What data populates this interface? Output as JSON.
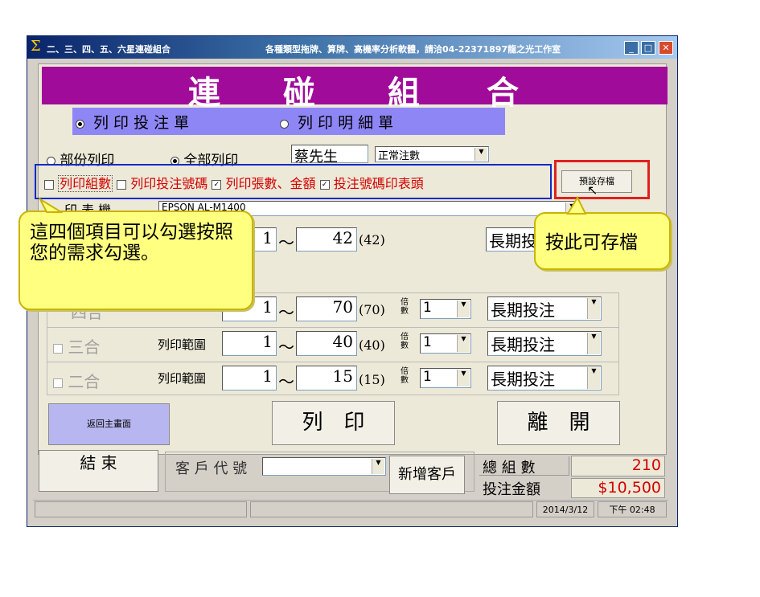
{
  "window": {
    "title": "二、三、四、五、六星連碰組合",
    "info": "各種類型拖牌、算牌、高機率分析軟體，請洽04-22371897龍之光工作室"
  },
  "banner": {
    "chars": [
      "連",
      "碰",
      "組",
      "合"
    ]
  },
  "print_mode": {
    "detail_label": "列 印 投 注 單",
    "summary_label": "列 印 明 細 單",
    "selected": "detail_label"
  },
  "scope": {
    "partial_label": "部份列印",
    "all_label": "全部列印",
    "selected": "all_label"
  },
  "customer_name": "蔡先生",
  "bet_type": "正常注數",
  "options": {
    "print_combo_count": "列印組數",
    "print_bet_numbers": "列印投注號碼",
    "print_sheets_amount": "列印張數、金額",
    "bet_numbers_table": "投注號碼印表頭"
  },
  "save_default_button": "預設存檔",
  "printer": {
    "label": "印 表 機",
    "value": "EPSON AL-M1400"
  },
  "ranges": [
    {
      "label": "",
      "from": "1",
      "sep": "～",
      "to": "42",
      "count": "(42)",
      "mode": "長期投注"
    },
    {
      "label": "四合",
      "from": "1",
      "sep": "～",
      "to": "70",
      "count": "(70)",
      "mult_label": "倍數",
      "mult": "1",
      "mode": "長期投注"
    },
    {
      "label": "三合",
      "range_label": "列印範圍",
      "from": "1",
      "sep": "～",
      "to": "40",
      "count": "(40)",
      "mult_label": "倍數",
      "mult": "1",
      "mode": "長期投注"
    },
    {
      "label": "二合",
      "range_label": "列印範圍",
      "from": "1",
      "sep": "～",
      "to": "15",
      "count": "(15)",
      "mult_label": "倍數",
      "mult": "1",
      "mode": "長期投注"
    }
  ],
  "buttons": {
    "back_main": "返回主畫面",
    "print": "列　印",
    "leave": "離　開",
    "finish": "結 束",
    "add_customer": "新增客戶"
  },
  "customer_code_label": "客 戶 代 號",
  "totals": {
    "combo_label": "總 組 數",
    "combo_value": "210",
    "amount_label": "投注金額",
    "amount_value": "$10,500"
  },
  "status": {
    "date": "2014/3/12",
    "time": "下午 02:48"
  },
  "annotations": {
    "left_callout": "這四個項目可以勾選按照您的需求勾選。",
    "right_callout": "按此可存檔"
  },
  "colors": {
    "banner": "#a00b9a",
    "print_bar": "#8f86f6",
    "back_button": "#b8b6f0",
    "callout": "#ffff80",
    "accent_red": "#d40000"
  }
}
